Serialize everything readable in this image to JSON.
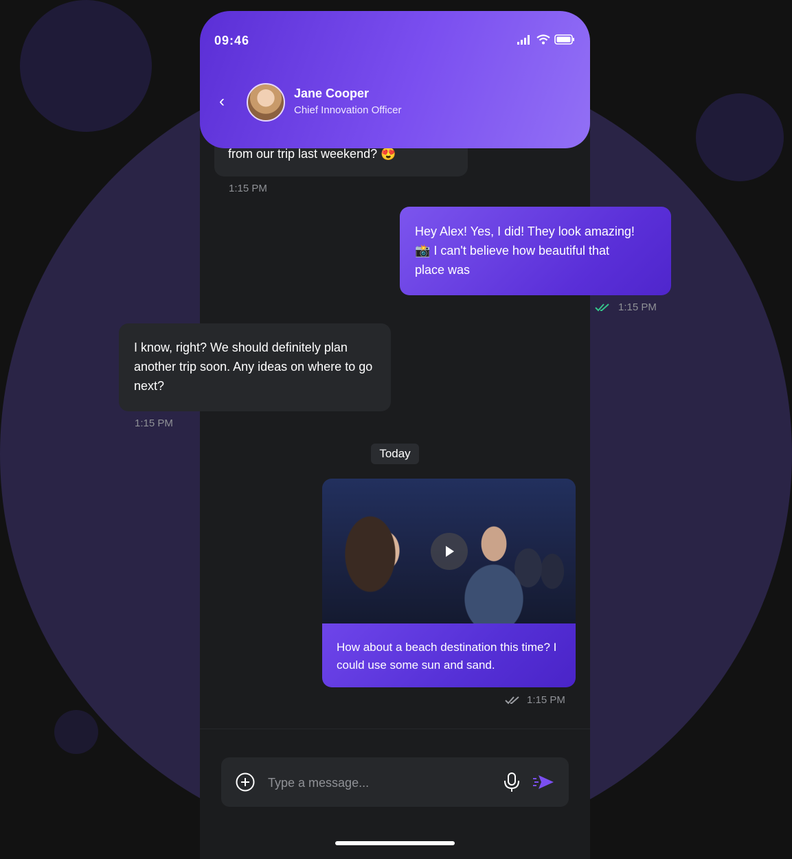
{
  "status_bar": {
    "time": "09:46"
  },
  "header": {
    "contact_name": "Jane Cooper",
    "contact_role": "Chief Innovation Officer"
  },
  "messages": [
    {
      "direction": "incoming",
      "text": "from our trip last weekend? 😍",
      "time": "1:15 PM"
    },
    {
      "direction": "outgoing",
      "text": "Hey Alex! Yes, I did! They look amazing! 📸 I can't believe how beautiful that place was",
      "time": "1:15 PM",
      "read": true
    },
    {
      "direction": "incoming",
      "text": "I know, right? We should definitely plan another trip soon. Any ideas on where to go next?",
      "time": "1:15 PM"
    }
  ],
  "day_separator": "Today",
  "media_message": {
    "caption": "How about a beach destination this time? I could use some sun and sand.",
    "time": "1:15 PM",
    "read": false
  },
  "composer": {
    "placeholder": "Type a message..."
  },
  "colors": {
    "accent": "#7b4ff0",
    "read_tick": "#35c48a",
    "background": "#121212"
  }
}
